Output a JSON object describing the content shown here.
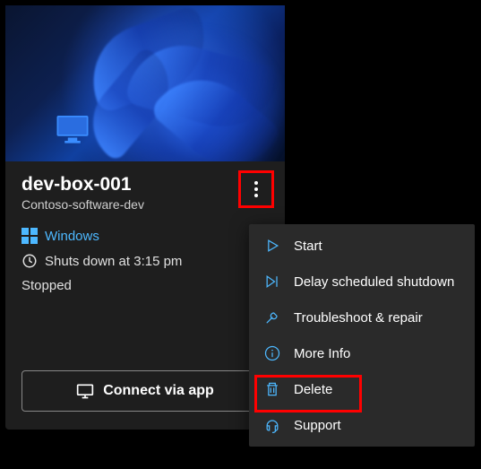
{
  "card": {
    "title": "dev-box-001",
    "subtitle": "Contoso-software-dev",
    "os_label": "Windows",
    "shutdown_label": "Shuts down at 3:15 pm",
    "status": "Stopped",
    "connect_label": "Connect via app"
  },
  "menu": {
    "items": [
      {
        "label": "Start"
      },
      {
        "label": "Delay scheduled shutdown"
      },
      {
        "label": "Troubleshoot & repair"
      },
      {
        "label": "More Info"
      },
      {
        "label": "Delete"
      },
      {
        "label": "Support"
      }
    ]
  },
  "colors": {
    "accent": "#4db8ff",
    "highlight": "#ff0000"
  }
}
